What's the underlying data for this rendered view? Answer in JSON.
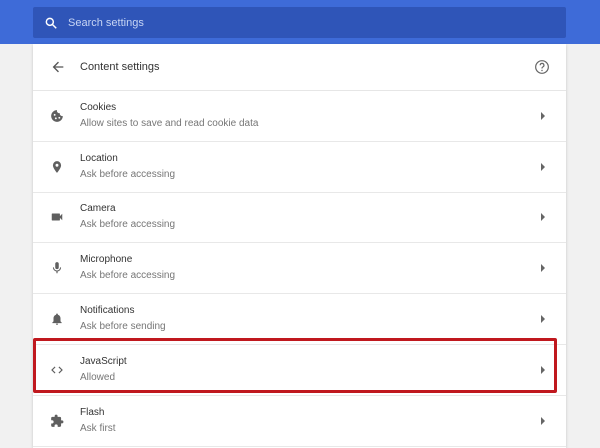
{
  "search": {
    "placeholder": "Search settings"
  },
  "header": {
    "title": "Content settings"
  },
  "rows": [
    {
      "name": "Cookies",
      "desc": "Allow sites to save and read cookie data",
      "icon": "cookie-icon"
    },
    {
      "name": "Location",
      "desc": "Ask before accessing",
      "icon": "location-pin-icon"
    },
    {
      "name": "Camera",
      "desc": "Ask before accessing",
      "icon": "camera-icon"
    },
    {
      "name": "Microphone",
      "desc": "Ask before accessing",
      "icon": "microphone-icon"
    },
    {
      "name": "Notifications",
      "desc": "Ask before sending",
      "icon": "bell-icon"
    },
    {
      "name": "JavaScript",
      "desc": "Allowed",
      "icon": "code-brackets-icon"
    },
    {
      "name": "Flash",
      "desc": "Ask first",
      "icon": "puzzle-icon"
    }
  ],
  "colors": {
    "topbar": "#3e6bd8",
    "search_bg": "#2f55b8",
    "highlight": "#c0181e"
  }
}
